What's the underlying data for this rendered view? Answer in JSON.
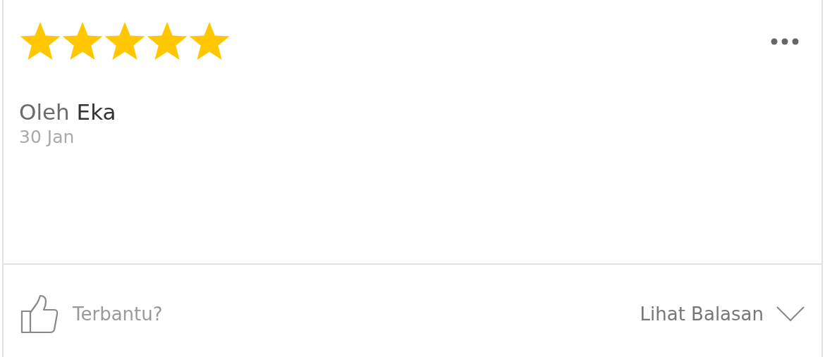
{
  "review": {
    "stars": 5,
    "byline": "Oleh **Eka**",
    "date": "30 Jan"
  },
  "footer": {
    "helpful_label": "Terbantu?",
    "replies_label": "Lihat Balasan"
  }
}
